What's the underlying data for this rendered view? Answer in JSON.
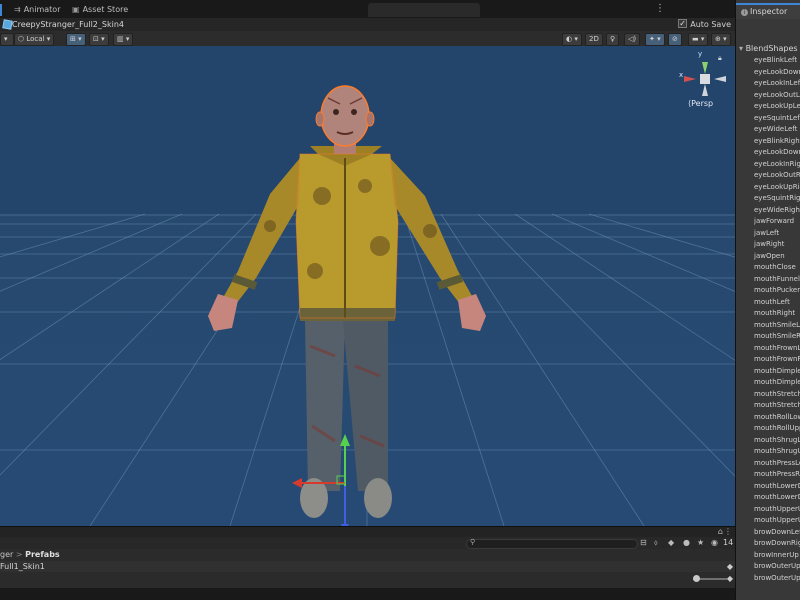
{
  "tabs": [
    {
      "label": "Animator",
      "icon": "animator-icon"
    },
    {
      "label": "Asset Store",
      "icon": "store-icon"
    }
  ],
  "prefab": {
    "name": "CreepyStranger_Full2_Skin4",
    "auto_save_label": "Auto Save",
    "auto_save": true
  },
  "scene_toolbar": {
    "pivot_label": "Local",
    "mode_2d": "2D"
  },
  "gizmo": {
    "x": "x",
    "y": "y",
    "persp": "Persp"
  },
  "hierarchy": {
    "breadcrumb": [
      "ger",
      "Prefabs"
    ],
    "selected_item": "Full1_Skin1",
    "visibility_count": "14"
  },
  "inspector": {
    "tab_label": "Inspector",
    "section": "BlendShapes",
    "blendshapes": [
      "eyeBlinkLeft",
      "eyeLookDownLeft",
      "eyeLookInLeft",
      "eyeLookOutLeft",
      "eyeLookUpLeft",
      "eyeSquintLeft",
      "eyeWideLeft",
      "eyeBlinkRight",
      "eyeLookDownRight",
      "eyeLookInRight",
      "eyeLookOutRight",
      "eyeLookUpRight",
      "eyeSquintRight",
      "eyeWideRight",
      "jawForward",
      "jawLeft",
      "jawRight",
      "jawOpen",
      "mouthClose",
      "mouthFunnel",
      "mouthPucker",
      "mouthLeft",
      "mouthRight",
      "mouthSmileLeft",
      "mouthSmileRight",
      "mouthFrownLeft",
      "mouthFrownRight",
      "mouthDimpleLeft",
      "mouthDimpleRight",
      "mouthStretchLeft",
      "mouthStretchRight",
      "mouthRollLower",
      "mouthRollUpper",
      "mouthShrugLower",
      "mouthShrugUpper",
      "mouthPressLeft",
      "mouthPressRight",
      "mouthLowerDownLeft",
      "mouthLowerDownRight",
      "mouthUpperUpLeft",
      "mouthUpperUpRight",
      "browDownLeft",
      "browDownRight",
      "browInnerUp",
      "browOuterUpLeft",
      "browOuterUpRight"
    ]
  },
  "colors": {
    "viewport": "#23446b",
    "accent": "#3d86d6",
    "jacket": "#b99a2c"
  }
}
